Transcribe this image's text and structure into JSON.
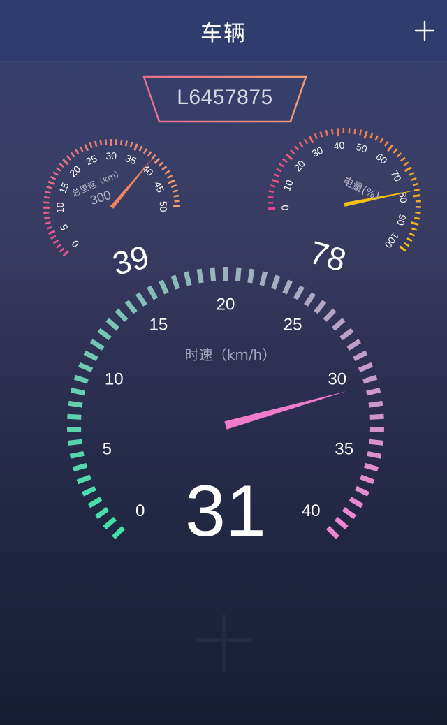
{
  "header": {
    "title": "车辆",
    "add_icon": "plus-icon"
  },
  "vehicle": {
    "plate": "L6457875"
  },
  "odometer_gauge": {
    "label": "总里程（km）",
    "total": "300",
    "value": 39,
    "min": 0,
    "max": 50,
    "ticks": [
      "0",
      "5",
      "10",
      "15",
      "20",
      "25",
      "30",
      "35",
      "40",
      "45",
      "50"
    ],
    "colors": {
      "start": "#e0548f",
      "end": "#f2a16b",
      "needle": "#f4845f"
    }
  },
  "battery_gauge": {
    "label": "电量(%)",
    "value": 78,
    "min": 0,
    "max": 100,
    "ticks": [
      "0",
      "10",
      "20",
      "30",
      "40",
      "50",
      "60",
      "70",
      "80",
      "90",
      "100"
    ],
    "colors": {
      "start": "#e6428e",
      "end": "#f5c510",
      "needle": "#f5c30f"
    }
  },
  "speed_gauge": {
    "label": "时速（km/h）",
    "value": 31,
    "min": 0,
    "max": 40,
    "ticks": [
      "0",
      "5",
      "10",
      "15",
      "20",
      "25",
      "30",
      "35",
      "40"
    ],
    "colors": {
      "start": "#40e2a8",
      "end": "#f284d2",
      "needle": "#f07bcc"
    }
  }
}
